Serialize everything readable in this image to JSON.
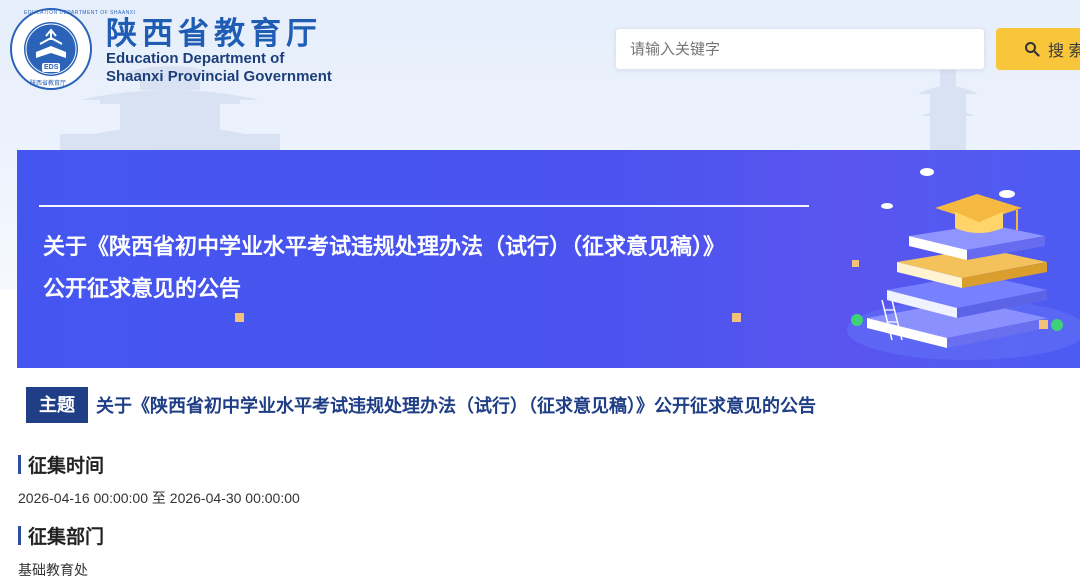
{
  "header": {
    "logo_text_top": "EDUCATION DEPARTMENT OF SHAANXI",
    "logo_text_bottom": "陕西省教育厅",
    "logo_badge": "EDS",
    "title_cn": "陕西省教育厅",
    "title_en_line1": "Education Department of",
    "title_en_line2": "Shaanxi Provincial Government",
    "search_placeholder": "请输入关键字",
    "search_button": "搜 索",
    "search_icon": "search-icon"
  },
  "banner": {
    "title_line1": "关于《陕西省初中学业水平考试违规处理办法（试行）（征求意见稿）》",
    "title_line2": "公开征求意见的公告",
    "illustration": "books-graduation-cap-illustration"
  },
  "content": {
    "subject_badge": "主题",
    "subject_text": "关于《陕西省初中学业水平考试违规处理办法（试行）（征求意见稿）》公开征求意见的公告",
    "sections": [
      {
        "label": "征集时间",
        "value": "2026-04-16 00:00:00 至 2026-04-30 00:00:00"
      },
      {
        "label": "征集部门",
        "value": "基础教育处"
      }
    ]
  },
  "colors": {
    "brand_blue": "#1f5db5",
    "navy": "#1f3e86",
    "banner_blue": "#4556f0",
    "search_yellow": "#f8c53b"
  }
}
